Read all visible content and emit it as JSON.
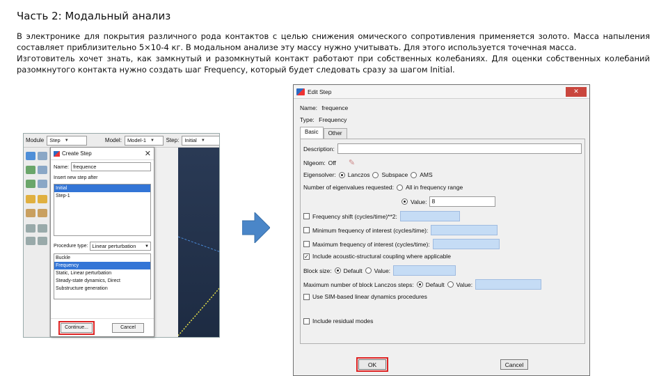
{
  "page": {
    "title": "Часть 2: Модальный анализ",
    "paragraph1": "В электронике для покрытия различного рода контактов с целью снижения омического сопротивления применяется золото. Масса напыления составляет приблизительно 5×10-4 кг. В модальном анализе эту массу нужно учитывать. Для этого используется точечная масса.",
    "paragraph2": "Изготовитель хочет знать, как замкнутый и разомкнутый контакт работают при собственных колебаниях. Для оценки собственных колебаний разомкнутого контакта нужно создать шаг Frequency, который будет следовать сразу за шагом Initial."
  },
  "left_screenshot": {
    "context_bar": {
      "module_label": "Module",
      "module_value": "Step",
      "model_label": "Model:",
      "model_value": "Model-1",
      "step_label": "Step:",
      "step_value": "Initial"
    },
    "create_step": {
      "title": "Create Step",
      "close": "✕",
      "name_label": "Name:",
      "name_value": "frequence",
      "insert_label": "Insert new step after",
      "steps": [
        "Initial",
        "Step-1"
      ],
      "procedure_label": "Procedure type:",
      "procedure_value": "Linear perturbation",
      "procedures": [
        "Buckle",
        "Frequency",
        "Static, Linear perturbation",
        "Steady-state dynamics, Direct",
        "Substructure generation"
      ],
      "continue_label": "Continue...",
      "cancel_label": "Cancel"
    }
  },
  "edit_step": {
    "title": "Edit Step",
    "close": "✕",
    "name_label": "Name:",
    "name_value": "frequence",
    "type_label": "Type:",
    "type_value": "Frequency",
    "tabs": [
      "Basic",
      "Other"
    ],
    "description_label": "Description:",
    "nlgeom_label": "Nlgeom:",
    "nlgeom_value": "Off",
    "eigensolver_label": "Eigensolver:",
    "eigensolvers": [
      "Lanczos",
      "Subspace",
      "AMS"
    ],
    "num_eigen_label": "Number of eigenvalues requested:",
    "all_in_range_label": "All in frequency range",
    "value_label": "Value:",
    "value_value": "8",
    "freq_shift_label": "Frequency shift (cycles/time)**2:",
    "min_freq_label": "Minimum frequency of interest (cycles/time):",
    "max_freq_label": "Maximum frequency of interest (cycles/time):",
    "acoustic_label": "Include acoustic-structural coupling where applicable",
    "block_size_label": "Block size:",
    "default_label": "Default",
    "value_label2": "Value:",
    "max_block_label": "Maximum number of block Lanczos steps:",
    "sim_label": "Use SIM-based linear dynamics procedures",
    "residual_label": "Include residual modes",
    "ok_label": "OK",
    "cancel_label": "Cancel",
    "checkmark": "✓"
  },
  "colors": {
    "selection": "#3375d6",
    "highlight_box": "#dd2222",
    "arrow": "#4a86c8",
    "blue_input": "#c5dcf5"
  }
}
